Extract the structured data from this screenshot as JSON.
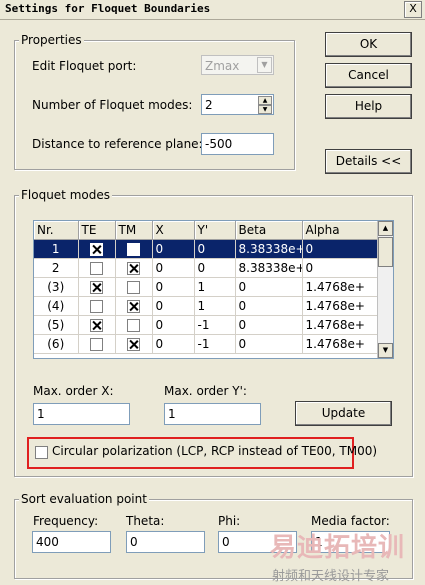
{
  "window": {
    "title": "Settings for Floquet Boundaries",
    "close_label": "X"
  },
  "buttons": {
    "ok": "OK",
    "cancel": "Cancel",
    "help": "Help",
    "details": "Details <<",
    "update": "Update"
  },
  "properties": {
    "legend": "Properties",
    "edit_port_label": "Edit Floquet port:",
    "edit_port_value": "Zmax",
    "num_modes_label": "Number of Floquet modes:",
    "num_modes_value": "2",
    "distance_label": "Distance to reference plane:",
    "distance_value": "-500"
  },
  "floquet": {
    "legend": "Floquet modes",
    "columns": [
      "Nr.",
      "TE",
      "TM",
      "X",
      "Y'",
      "Beta",
      "Alpha"
    ],
    "rows": [
      {
        "nr": "1",
        "te": true,
        "tm": false,
        "x": "0",
        "y": "0",
        "beta": "8.38338e+",
        "alpha": "0",
        "selected": true
      },
      {
        "nr": "2",
        "te": false,
        "tm": true,
        "x": "0",
        "y": "0",
        "beta": "8.38338e+",
        "alpha": "0",
        "selected": false
      },
      {
        "nr": "(3)",
        "te": true,
        "tm": false,
        "x": "0",
        "y": "1",
        "beta": "0",
        "alpha": "1.4768e+",
        "selected": false
      },
      {
        "nr": "(4)",
        "te": false,
        "tm": true,
        "x": "0",
        "y": "1",
        "beta": "0",
        "alpha": "1.4768e+",
        "selected": false
      },
      {
        "nr": "(5)",
        "te": true,
        "tm": false,
        "x": "0",
        "y": "-1",
        "beta": "0",
        "alpha": "1.4768e+",
        "selected": false
      },
      {
        "nr": "(6)",
        "te": false,
        "tm": true,
        "x": "0",
        "y": "-1",
        "beta": "0",
        "alpha": "1.4768e+",
        "selected": false
      }
    ],
    "max_x_label": "Max. order X:",
    "max_x_value": "1",
    "max_y_label": "Max. order Y':",
    "max_y_value": "1",
    "circular_label": "Circular polarization (LCP, RCP instead of TE00, TM00)",
    "circular_checked": false
  },
  "sort": {
    "legend": "Sort evaluation point",
    "frequency_label": "Frequency:",
    "frequency_value": "400",
    "theta_label": "Theta:",
    "theta_value": "0",
    "phi_label": "Phi:",
    "phi_value": "0",
    "media_label": "Media factor:",
    "media_value": "1"
  },
  "watermark": {
    "line1": "易迪拓培训",
    "line2": "射频和天线设计专家"
  },
  "colors": {
    "selection": "#0a246a",
    "highlight_box": "#e02020",
    "dialog_bg": "#ece9d8"
  }
}
